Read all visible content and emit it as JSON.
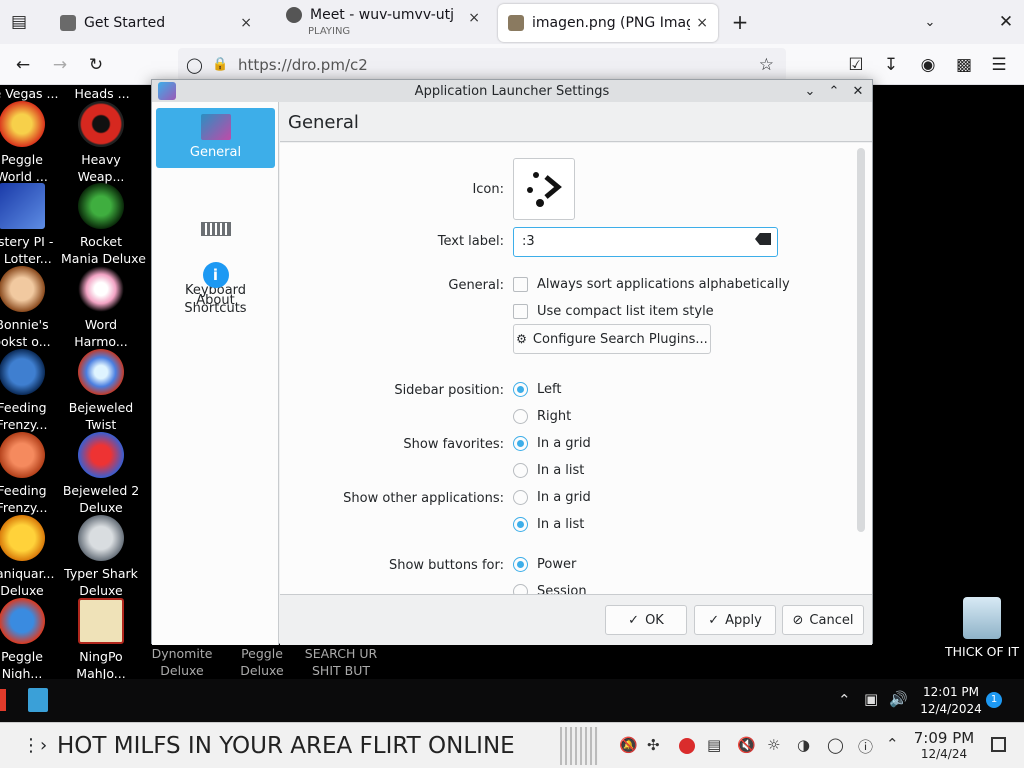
{
  "browser": {
    "tabs": [
      {
        "label": "Get Started",
        "close": "×"
      },
      {
        "label": "Meet - wuv-umvv-utj",
        "sub": "PLAYING",
        "close": "×"
      },
      {
        "label": "imagen.png (PNG Image",
        "close": "×"
      }
    ],
    "new_tab": "+",
    "url": "https://dro.pm/c2"
  },
  "desktop": {
    "icons": [
      {
        "label": "e Vegas ..."
      },
      {
        "label": "Heads ..."
      },
      {
        "label": "Peggle\nWorld ..."
      },
      {
        "label": "Heavy\nWeap..."
      },
      {
        "label": "ystery PI -\ne Lotter..."
      },
      {
        "label": "Rocket\nMania Deluxe"
      },
      {
        "label": "Bonnie's\nookst o..."
      },
      {
        "label": "Word\nHarmo..."
      },
      {
        "label": "Feeding\nFrenzy..."
      },
      {
        "label": "Bejeweled\nTwist"
      },
      {
        "label": "Feeding\nFrenzy..."
      },
      {
        "label": "Bejeweled 2\nDeluxe"
      },
      {
        "label": "saniquar...\nDeluxe"
      },
      {
        "label": "Typer Shark\nDeluxe"
      },
      {
        "label": "Peggle\nNigh..."
      },
      {
        "label": "NingPo\nMahJo..."
      }
    ],
    "strip": [
      "Dynomite\nDeluxe",
      "Peggle\nDeluxe",
      "SEARCH UR\nSHIT BUT"
    ],
    "recycle_label": "THICK OF IT"
  },
  "dialog": {
    "title": "Application Launcher Settings",
    "sidebar": [
      {
        "label": "General"
      },
      {
        "label": "Keyboard\nShortcuts"
      },
      {
        "label": "About"
      }
    ],
    "page_title": "General",
    "icon_label": "Icon:",
    "text_label_label": "Text label:",
    "text_label_value": ":3",
    "general_label": "General:",
    "opt_sort": "Always sort applications alphabetically",
    "opt_compact": "Use compact list item style",
    "configure_btn": "Configure Search Plugins...",
    "sidebar_position_label": "Sidebar position:",
    "left": "Left",
    "right": "Right",
    "show_favorites_label": "Show favorites:",
    "in_grid": "In a grid",
    "in_list": "In a list",
    "show_other_label": "Show other applications:",
    "show_buttons_label": "Show buttons for:",
    "power": "Power",
    "session": "Session",
    "ok": "OK",
    "apply": "Apply",
    "cancel": "Cancel"
  },
  "taskbar": {
    "time": "12:01 PM",
    "date": "12/4/2024",
    "notif_count": "1"
  },
  "host_taskbar": {
    "banner": "HOT MILFS IN YOUR AREA FLIRT ONLINE",
    "time": "7:09 PM",
    "date": "12/4/24"
  }
}
